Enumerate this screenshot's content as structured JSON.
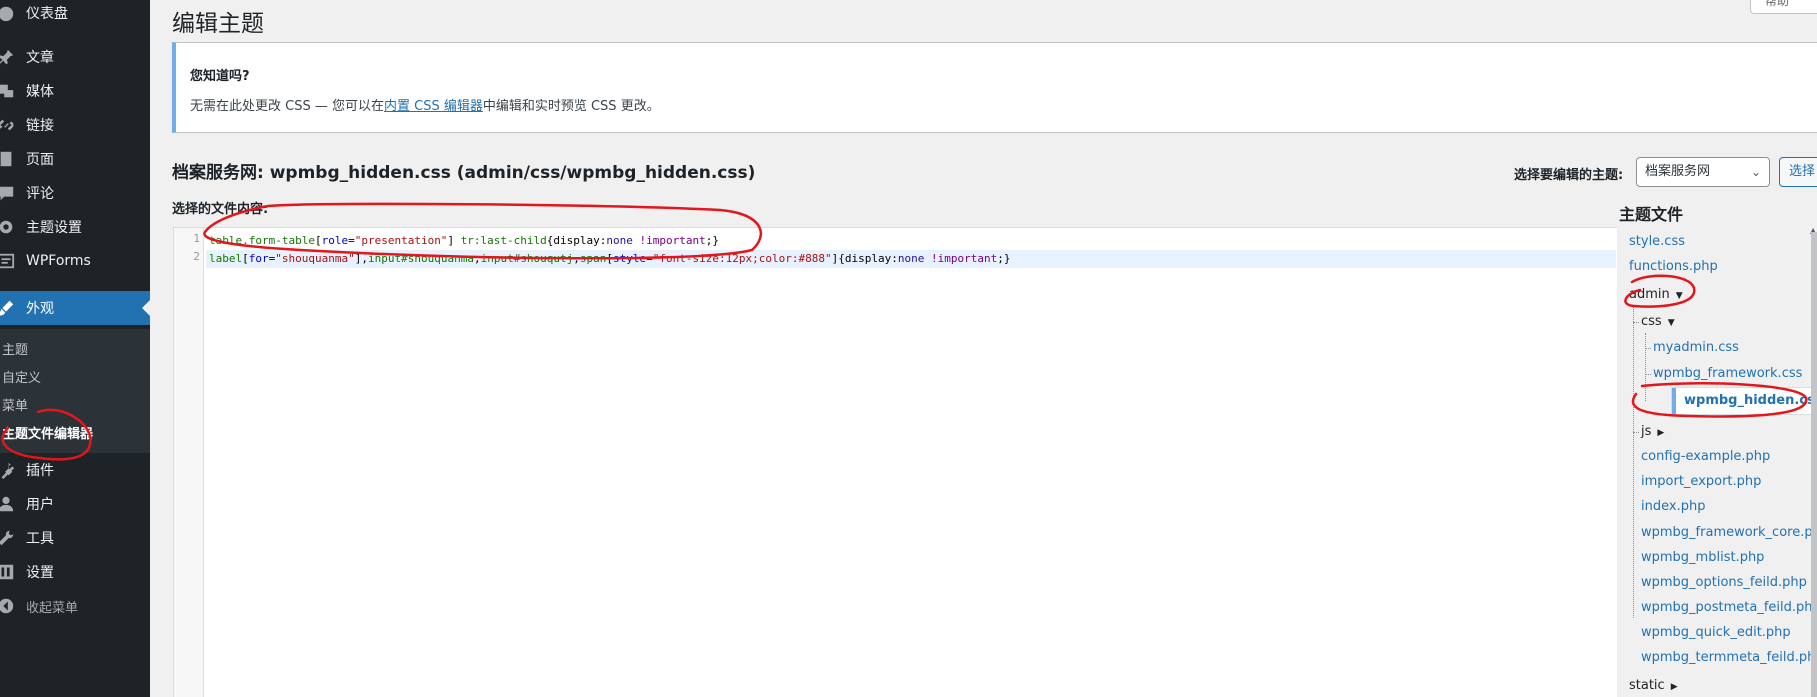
{
  "sidebar": {
    "items": [
      {
        "label": "仪表盘",
        "icon": "dashboard-icon"
      },
      {
        "label": "文章",
        "icon": "pin-icon"
      },
      {
        "label": "媒体",
        "icon": "media-icon"
      },
      {
        "label": "链接",
        "icon": "link-icon"
      },
      {
        "label": "页面",
        "icon": "page-icon"
      },
      {
        "label": "评论",
        "icon": "comment-icon"
      },
      {
        "label": "主题设置",
        "icon": "gear-icon"
      },
      {
        "label": "WPForms",
        "icon": "forms-icon"
      },
      {
        "label": "外观",
        "icon": "brush-icon"
      },
      {
        "label": "插件",
        "icon": "plugin-icon"
      },
      {
        "label": "用户",
        "icon": "user-icon"
      },
      {
        "label": "工具",
        "icon": "wrench-icon"
      },
      {
        "label": "设置",
        "icon": "settings-icon"
      },
      {
        "label": "收起菜单",
        "icon": "collapse-icon"
      }
    ],
    "submenu": [
      "主题",
      "自定义",
      "菜单",
      "主题文件编辑器"
    ]
  },
  "header": {
    "title": "编辑主题",
    "help_tab": "帮助"
  },
  "notice": {
    "title": "您知道吗?",
    "text_before": "无需在此处更改 CSS — 您可以在",
    "link": "内置 CSS 编辑器",
    "text_after": "中编辑和实时预览 CSS 更改。"
  },
  "file": {
    "theme_name": "档案服务网",
    "heading_rest": ": wpmbg_hidden.css (admin/css/wpmbg_hidden.css)",
    "select_label": "选择要编辑的主题:",
    "select_value": "档案服务网",
    "select_button": "选择",
    "content_label": "选择的文件内容:"
  },
  "editor": {
    "lines": [
      {
        "no": "1",
        "tokens": [
          {
            "t": "table.form-table",
            "c": "c-sel"
          },
          {
            "t": "[",
            "c": "c-prop"
          },
          {
            "t": "role",
            "c": "c-attr"
          },
          {
            "t": "=",
            "c": "c-prop"
          },
          {
            "t": "\"presentation\"",
            "c": "c-str"
          },
          {
            "t": "] ",
            "c": "c-prop"
          },
          {
            "t": "tr:last-child",
            "c": "c-sel"
          },
          {
            "t": "{",
            "c": "c-prop"
          },
          {
            "t": "display",
            "c": "c-prop"
          },
          {
            "t": ":",
            "c": "c-prop"
          },
          {
            "t": "none",
            "c": "c-val"
          },
          {
            "t": " !important",
            "c": "c-imp"
          },
          {
            "t": ";}",
            "c": "c-prop"
          }
        ]
      },
      {
        "no": "2",
        "tokens": [
          {
            "t": "label",
            "c": "c-sel"
          },
          {
            "t": "[",
            "c": "c-prop"
          },
          {
            "t": "for",
            "c": "c-attr"
          },
          {
            "t": "=",
            "c": "c-prop"
          },
          {
            "t": "\"shouquanma\"",
            "c": "c-str"
          },
          {
            "t": "],",
            "c": "c-prop"
          },
          {
            "t": "input#shouquanma",
            "c": "c-sel"
          },
          {
            "t": ",",
            "c": "c-prop"
          },
          {
            "t": "input#shouqutj",
            "c": "c-sel"
          },
          {
            "t": ",",
            "c": "c-prop"
          },
          {
            "t": "span",
            "c": "c-sel"
          },
          {
            "t": "[",
            "c": "c-prop"
          },
          {
            "t": "style",
            "c": "c-attr"
          },
          {
            "t": "=",
            "c": "c-prop"
          },
          {
            "t": "\"font-size:12px;color:#888\"",
            "c": "c-str"
          },
          {
            "t": "]{",
            "c": "c-prop"
          },
          {
            "t": "display",
            "c": "c-prop"
          },
          {
            "t": ":",
            "c": "c-prop"
          },
          {
            "t": "none",
            "c": "c-val"
          },
          {
            "t": " !important",
            "c": "c-imp"
          },
          {
            "t": ";}",
            "c": "c-prop"
          }
        ]
      }
    ]
  },
  "files": {
    "title": "主题文件",
    "style": "style.css",
    "functions": "functions.php",
    "admin": "admin",
    "css": "css",
    "myadmin": "myadmin.css",
    "framework_css": "wpmbg_framework.css",
    "hidden_css": "wpmbg_hidden.css",
    "js": "js",
    "config": "config-example.php",
    "import_export": "import_export.php",
    "index": "index.php",
    "framework_core": "wpmbg_framework_core.php",
    "mblist": "wpmbg_mblist.php",
    "options": "wpmbg_options_feild.php",
    "postmeta": "wpmbg_postmeta_feild.php",
    "quick_edit": "wpmbg_quick_edit.php",
    "termmeta": "wpmbg_termmeta_feild.php",
    "static": "static"
  },
  "colors": {
    "sidebar_bg": "#1d2327",
    "accent": "#2271b1",
    "annotation": "#e3161b"
  }
}
